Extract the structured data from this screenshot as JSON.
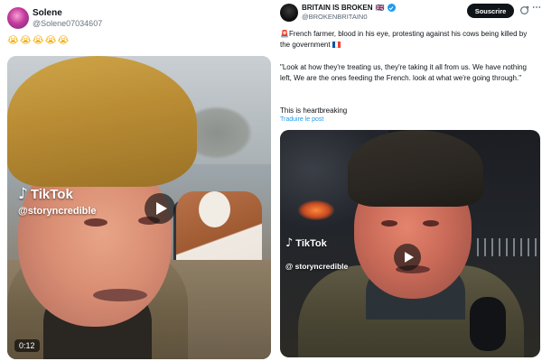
{
  "left_post": {
    "author_name": "Solene",
    "author_handle": "@Solene07034607",
    "emoji": [
      "😭",
      "😭",
      "😭",
      "😭",
      "😭"
    ],
    "video": {
      "watermark_brand": "TikTok",
      "watermark_user": "@storyncredible",
      "duration": "0:12"
    }
  },
  "right_post": {
    "author_name": "BRITAIN IS BROKEN",
    "author_flag": "🇬🇧",
    "author_handle": "@BROKENBRITAIN0",
    "subscribe_label": "Souscrire",
    "siren": "🚨",
    "text_1": "French farmer, blood in his eye, protesting against his cows being killed by the government",
    "text_2": "\"Look at how they're treating us, they're taking it all from us. We have nothing left, We are the ones feeding the French. look at what we're going through.\"",
    "text_3": "This is heartbreaking",
    "translate_label": "Traduire le post",
    "video": {
      "watermark_brand": "TikTok",
      "watermark_user": "@ storyncredible"
    }
  },
  "colors": {
    "accent_blue": "#1d9bf0",
    "subscribe_bg": "#0f1419",
    "handle_gray": "#536471"
  },
  "icons": [
    "tiktok-logo-icon",
    "play-icon",
    "verified-badge-icon",
    "grok-icon",
    "more-options-icon",
    "siren-icon",
    "french-flag-icon"
  ]
}
